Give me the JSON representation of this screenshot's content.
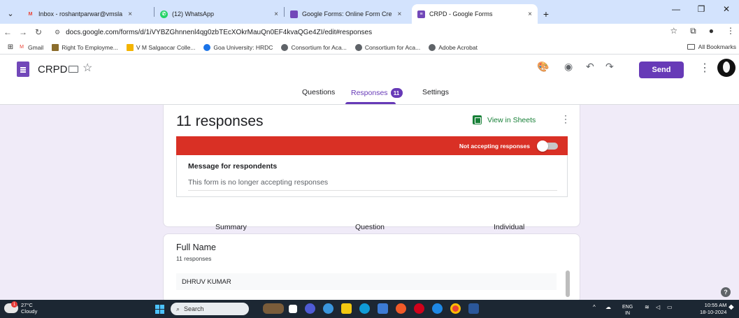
{
  "browser": {
    "tabs": [
      {
        "title": "Inbox - roshantparwar@vmsla",
        "close": "×",
        "favicon": "gmail-icon"
      },
      {
        "title": "(12) WhatsApp",
        "close": "",
        "favicon": "whatsapp-icon"
      },
      {
        "title": "Google Forms: Online Form Cre",
        "close": "×",
        "favicon": "google-forms-doc-icon"
      },
      {
        "title": "CRPD - Google Forms",
        "close": "×",
        "favicon": "google-forms-icon"
      }
    ],
    "new_tab": "+",
    "url": "docs.google.com/forms/d/1iVYBZGhnnenl4qg0zbTEcXOkrMauQn0EF4kvaQGe4ZI/edit#responses",
    "bookmarks": [
      "Gmail",
      "Right To Employme...",
      "V M Salgaocar Colle...",
      "Goa University: HRDC",
      "Consortium for Aca...",
      "Consortium for Aca...",
      "Adobe Acrobat"
    ],
    "all_bookmarks": "All Bookmarks"
  },
  "form": {
    "title": "CRPD",
    "send_label": "Send",
    "tabs": {
      "questions": "Questions",
      "responses": "Responses",
      "responses_badge": "11",
      "settings": "Settings"
    }
  },
  "responses": {
    "count_title": "11 responses",
    "view_in_sheets": "View in Sheets",
    "not_accepting": "Not accepting responses",
    "message_label": "Message for respondents",
    "message_text": "This form is no longer accepting responses",
    "subtabs": [
      "Summary",
      "Question",
      "Individual"
    ]
  },
  "question": {
    "title": "Full Name",
    "count": "11 responses",
    "answers": [
      "DHRUV KUMAR"
    ]
  },
  "taskbar": {
    "weather_temp": "27°C",
    "weather_desc": "Cloudy",
    "weather_badge": "1",
    "search": "Search",
    "lang": "ENG",
    "region": "IN",
    "time": "10:55 AM",
    "date": "18-10-2024"
  },
  "colors": {
    "accent": "#673ab7",
    "banner_red": "#d93025",
    "sheets_green": "#188038"
  }
}
